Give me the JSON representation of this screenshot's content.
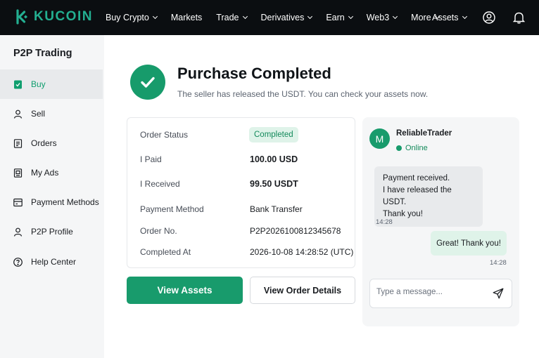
{
  "brand": {
    "name": "KUCOIN",
    "color": "#23af91"
  },
  "nav": {
    "items": [
      {
        "label": "Buy Crypto",
        "dropdown": true
      },
      {
        "label": "Markets",
        "dropdown": false
      },
      {
        "label": "Trade",
        "dropdown": true
      },
      {
        "label": "Derivatives",
        "dropdown": true
      },
      {
        "label": "Earn",
        "dropdown": true
      },
      {
        "label": "Web3",
        "dropdown": true
      },
      {
        "label": "More",
        "dropdown": true
      }
    ],
    "assets_label": "Assets"
  },
  "sidebar": {
    "title": "P2P Trading",
    "items": [
      {
        "label": "Buy",
        "icon": "buy-icon",
        "active": true
      },
      {
        "label": "Sell",
        "icon": "user-icon",
        "active": false
      },
      {
        "label": "Orders",
        "icon": "document-icon",
        "active": false
      },
      {
        "label": "My Ads",
        "icon": "ad-icon",
        "active": false
      },
      {
        "label": "Payment Methods",
        "icon": "card-icon",
        "active": false
      },
      {
        "label": "P2P Profile",
        "icon": "profile-icon",
        "active": false
      },
      {
        "label": "Help Center",
        "icon": "help-icon",
        "active": false
      }
    ]
  },
  "status": {
    "title": "Purchase Completed",
    "subtitle": "The seller has released the USDT. You can check your assets now."
  },
  "order": {
    "status_label": "Order Status",
    "status_value": "Completed",
    "paid_label": "I Paid",
    "paid_value": "100.00 USD",
    "received_label": "I Received",
    "received_value": "99.50 USDT",
    "payment_method_label": "Payment Method",
    "payment_method_value": "Bank Transfer",
    "order_no_label": "Order No.",
    "order_no_value": "P2P2026100812345678",
    "completed_at_label": "Completed At",
    "completed_at_value": "2026-10-08 14:28:52 (UTC)"
  },
  "actions": {
    "view_assets": "View Assets",
    "view_order_details": "View Order Details"
  },
  "chat": {
    "avatar_initial": "M",
    "trader_name": "ReliableTrader",
    "presence": "Online",
    "incoming": {
      "lines": [
        "Payment received.",
        "I have released the USDT.",
        "Thank you!"
      ],
      "time": "14:28"
    },
    "outgoing": {
      "text": "Great! Thank you!",
      "time": "14:28"
    },
    "input_placeholder": "Type a message..."
  },
  "colors": {
    "accent": "#189b6c",
    "nav_bg": "#0b0e11",
    "sidebar_bg": "#f5f6f7",
    "badge_bg": "#dff3e9"
  }
}
